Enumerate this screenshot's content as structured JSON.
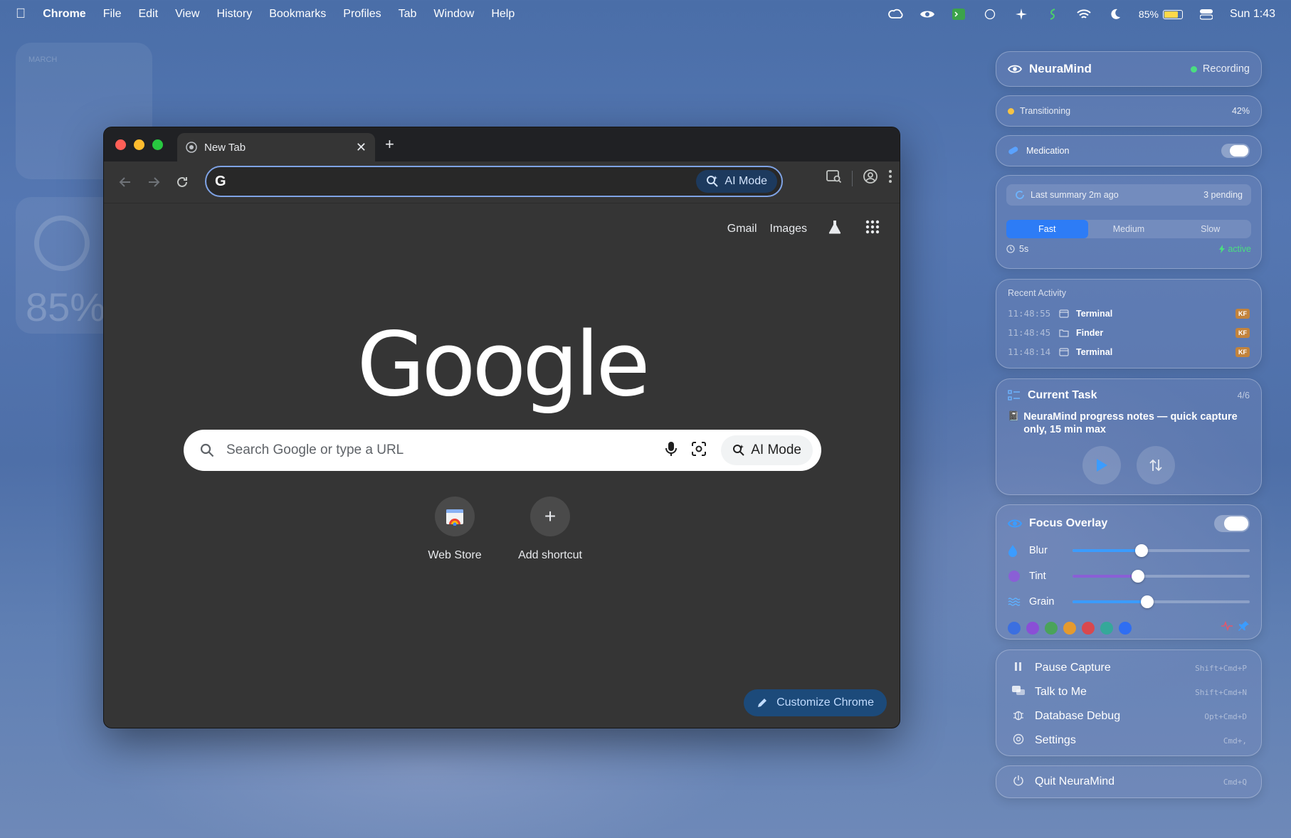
{
  "menubar": {
    "app": "Chrome",
    "items": [
      "File",
      "Edit",
      "View",
      "History",
      "Bookmarks",
      "Profiles",
      "Tab",
      "Window",
      "Help"
    ],
    "battery": "85%",
    "clock": "Sun 1:43"
  },
  "desktop": {
    "calendar_month": "MARCH",
    "battery_widget": "85%"
  },
  "chrome": {
    "tab_title": "New Tab",
    "omnibox_ai": "AI Mode",
    "toplinks": {
      "gmail": "Gmail",
      "images": "Images"
    },
    "logo": "Google",
    "search_placeholder": "Search Google or type a URL",
    "search_ai": "AI Mode",
    "shortcuts": [
      {
        "label": "Web Store"
      },
      {
        "label": "Add shortcut"
      }
    ],
    "customize": "Customize Chrome"
  },
  "neuramind": {
    "header": {
      "title": "NeuraMind",
      "status": "Recording"
    },
    "state": {
      "label": "Transitioning",
      "percent": "42%",
      "value": 42
    },
    "medication": {
      "label": "Medication",
      "on": true
    },
    "summary": {
      "last": "Last summary 2m ago",
      "pending": "3 pending",
      "speeds": [
        "Fast",
        "Medium",
        "Slow"
      ],
      "selected": "Fast",
      "interval": "5s",
      "status": "active"
    },
    "activity": {
      "title": "Recent Activity",
      "items": [
        {
          "time": "11:48:55",
          "app": "Terminal",
          "tag": "KF"
        },
        {
          "time": "11:48:45",
          "app": "Finder",
          "tag": "KF"
        },
        {
          "time": "11:48:14",
          "app": "Terminal",
          "tag": "KF"
        }
      ]
    },
    "task": {
      "title": "Current Task",
      "progress": "4/6",
      "text": "NeuraMind progress notes — quick capture only, 15 min max"
    },
    "focus": {
      "title": "Focus Overlay",
      "sliders": [
        {
          "label": "Blur",
          "value": 0.39
        },
        {
          "label": "Tint",
          "value": 0.37
        },
        {
          "label": "Grain",
          "value": 0.42
        }
      ],
      "swatches": [
        "#3b6fe0",
        "#8a4fd6",
        "#4aa35a",
        "#e59a2e",
        "#d9484e",
        "#35a89a",
        "#2f6ef2"
      ]
    },
    "menu": [
      {
        "label": "Pause Capture",
        "shortcut": "Shift+Cmd+P"
      },
      {
        "label": "Talk to Me",
        "shortcut": "Shift+Cmd+N"
      },
      {
        "label": "Database Debug",
        "shortcut": "Opt+Cmd+D"
      },
      {
        "label": "Settings",
        "shortcut": "Cmd+,"
      }
    ],
    "quit": {
      "label": "Quit NeuraMind",
      "shortcut": "Cmd+Q"
    }
  }
}
